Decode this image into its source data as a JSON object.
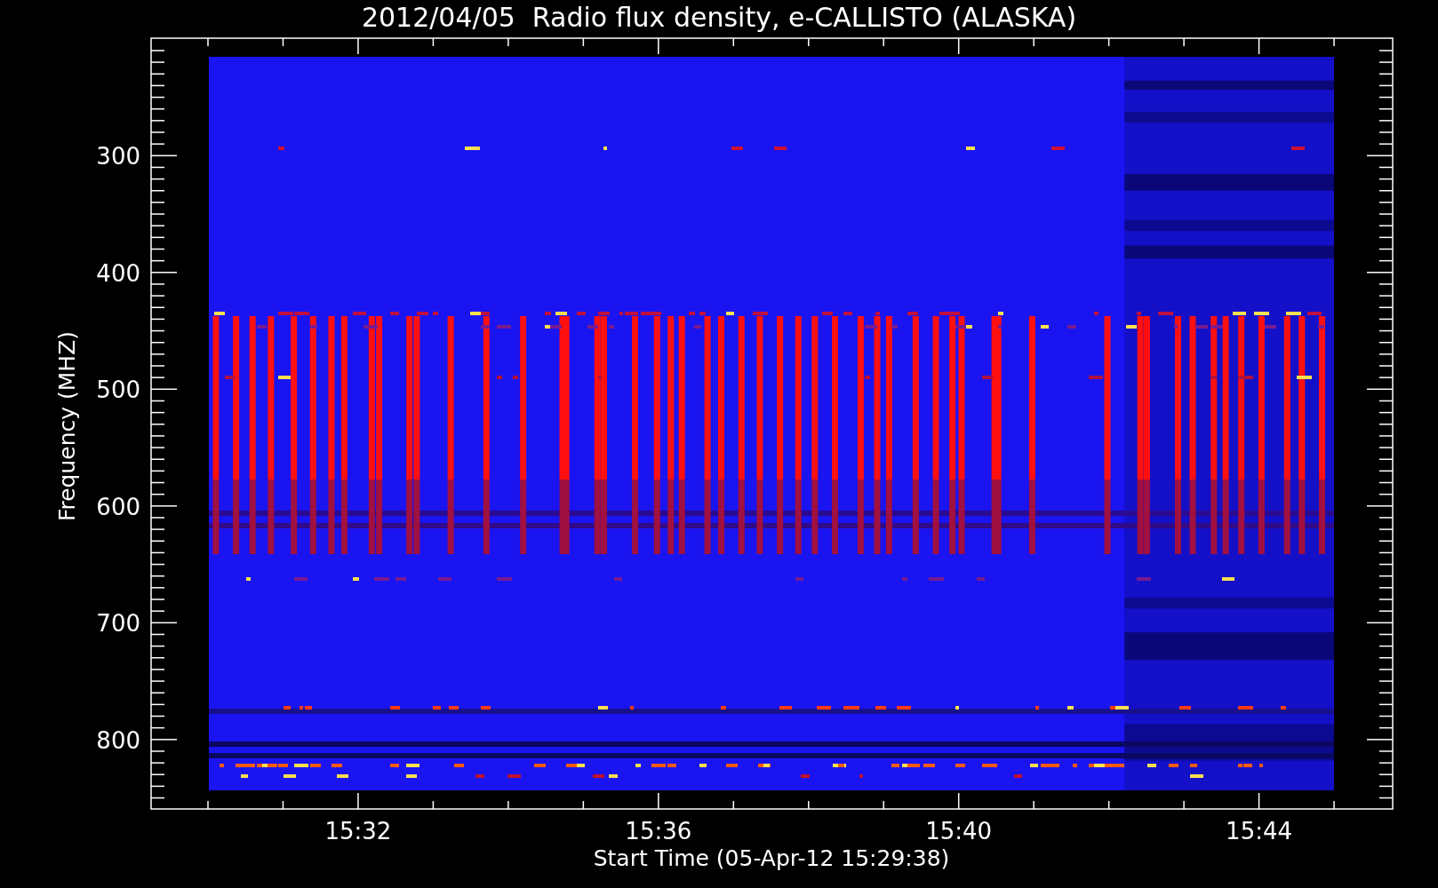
{
  "title": "2012/04/05  Radio flux density, e-CALLISTO (ALASKA)",
  "y_axis": {
    "label": "Frequency (MHZ)",
    "ticks": [
      "300",
      "400",
      "500",
      "600",
      "700",
      "800"
    ]
  },
  "x_axis": {
    "label": "Start Time (05-Apr-12 15:29:38)",
    "ticks": [
      "15:32",
      "15:36",
      "15:40",
      "15:44"
    ]
  }
}
